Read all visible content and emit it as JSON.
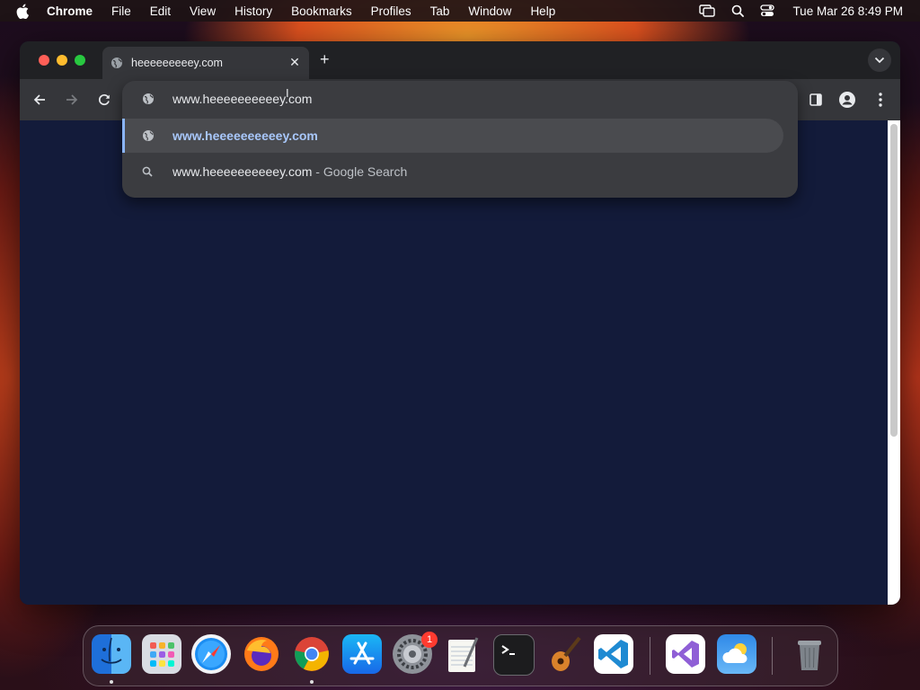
{
  "menubar": {
    "app": "Chrome",
    "items": [
      "File",
      "Edit",
      "View",
      "History",
      "Bookmarks",
      "Profiles",
      "Tab",
      "Window",
      "Help"
    ],
    "clock": "Tue Mar 26  8:49 PM"
  },
  "browser": {
    "tab_title": "heeeeeeeeey.com",
    "omnibox_value": "www.heeeeeeeeeey.com",
    "suggestions": [
      {
        "text": "www.heeeeeeeeeey.com",
        "sub": "",
        "icon": "globe-icon",
        "selected": true
      },
      {
        "text": "www.heeeeeeeeeey.com",
        "sub": " - Google Search",
        "icon": "search-icon",
        "selected": false
      }
    ]
  },
  "dock": {
    "apps": [
      "Finder",
      "Launchpad",
      "Safari",
      "Firefox",
      "Chrome",
      "App Store",
      "System Settings",
      "TextEdit",
      "Terminal",
      "GarageBand",
      "Visual Studio Code",
      "Visual Studio",
      "Weather",
      "Trash"
    ],
    "settings_badge": "1"
  },
  "colors": {
    "accent": "#8ab4f8",
    "page_bg": "#131b3a",
    "toolbar": "#35363a"
  }
}
